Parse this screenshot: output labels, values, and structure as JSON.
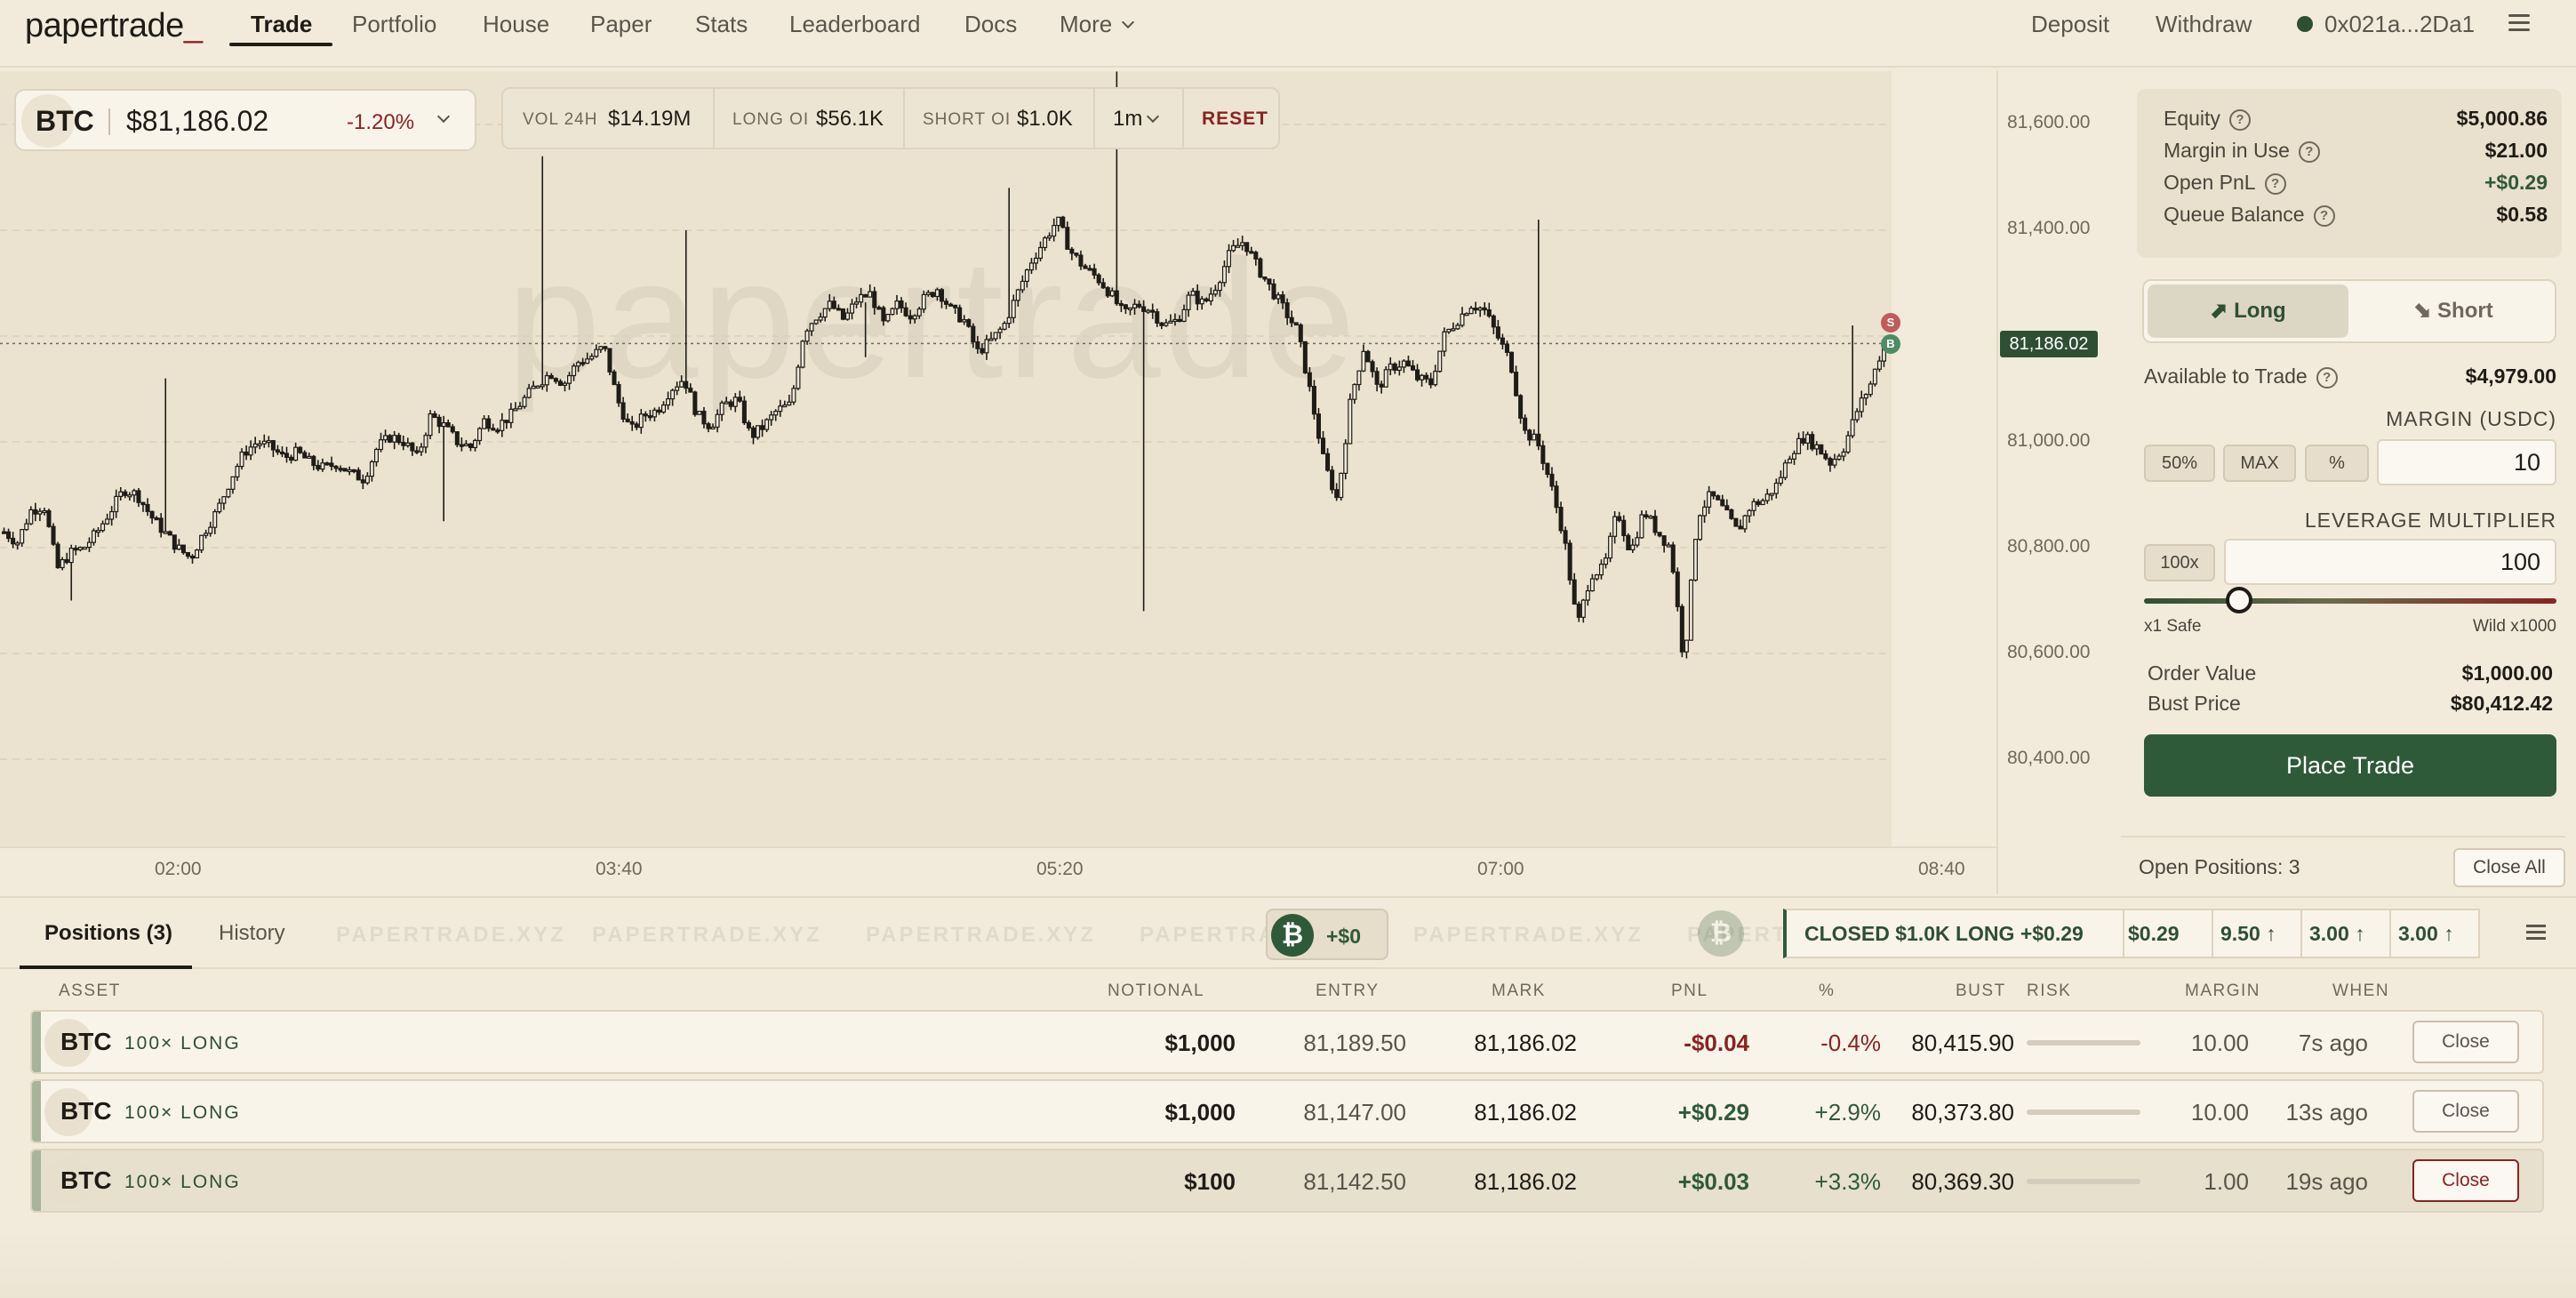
{
  "app": {
    "logo": "papertrade",
    "logo_cursor": "_"
  },
  "nav": {
    "items": [
      "Trade",
      "Portfolio",
      "House",
      "Paper",
      "Stats",
      "Leaderboard",
      "Docs",
      "More"
    ],
    "deposit": "Deposit",
    "withdraw": "Withdraw",
    "wallet": "0x021a...2Da1"
  },
  "ticker": {
    "symbol": "BTC",
    "price": "$81,186.02",
    "change": "-1.20%"
  },
  "stats": {
    "vol_label": "VOL 24H",
    "vol_value": "$14.19M",
    "long_label": "LONG OI",
    "long_value": "$56.1K",
    "short_label": "SHORT OI",
    "short_value": "$1.0K",
    "interval": "1m",
    "reset": "RESET"
  },
  "chart": {
    "watermark": "papertrade",
    "current_price": "81,186.02",
    "markers": [
      "S",
      "B"
    ]
  },
  "chart_data": {
    "type": "candlestick",
    "y_ticks": [
      "81,600.00",
      "81,400.00",
      "81,200.00",
      "81,000.00",
      "80,800.00",
      "80,600.00",
      "80,400.00"
    ],
    "y_tick_values": [
      81600,
      81400,
      81200,
      81000,
      80800,
      80600,
      80400
    ],
    "x_ticks": [
      "02:00",
      "03:40",
      "05:20",
      "07:00",
      "08:40"
    ],
    "ylim": [
      80300,
      81800
    ],
    "last_price": 81186.02,
    "close_path": [
      80830,
      80810,
      80870,
      80880,
      80760,
      80790,
      80800,
      80830,
      80870,
      80910,
      80900,
      80860,
      80830,
      80800,
      80780,
      80830,
      80870,
      80930,
      80980,
      81000,
      80990,
      80970,
      80980,
      80960,
      80950,
      80960,
      80940,
      80930,
      80990,
      81010,
      81000,
      80970,
      81050,
      81030,
      81000,
      80990,
      81040,
      81030,
      81050,
      81080,
      81110,
      81130,
      81110,
      81150,
      81160,
      81180,
      81080,
      81020,
      81050,
      81060,
      81100,
      81120,
      81050,
      81030,
      81070,
      81080,
      81010,
      81030,
      81060,
      81070,
      81210,
      81240,
      81260,
      81230,
      81270,
      81280,
      81220,
      81260,
      81240,
      81270,
      81290,
      81250,
      81230,
      81170,
      81190,
      81220,
      81280,
      81340,
      81380,
      81420,
      81360,
      81330,
      81310,
      81280,
      81240,
      81260,
      81250,
      81220,
      81230,
      81280,
      81260,
      81300,
      81360,
      81380,
      81330,
      81290,
      81250,
      81210,
      81090,
      80960,
      80890,
      81080,
      81180,
      81100,
      81140,
      81150,
      81120,
      81110,
      81200,
      81230,
      81260,
      81250,
      81200,
      81150,
      81020,
      81000,
      80920,
      80820,
      80650,
      80750,
      80760,
      80870,
      80790,
      80870,
      80830,
      80800,
      80580,
      80860,
      80900,
      80870,
      80830,
      80880,
      80890,
      80920,
      80980,
      81010,
      80990,
      80960,
      80990,
      81060,
      81110,
      81186
    ]
  },
  "account": {
    "equity_label": "Equity",
    "equity": "$5,000.86",
    "margin_label": "Margin in Use",
    "margin": "$21.00",
    "pnl_label": "Open PnL",
    "pnl": "+$0.29",
    "queue_label": "Queue Balance",
    "queue": "$0.58"
  },
  "trade": {
    "long": "Long",
    "short": "Short",
    "available_label": "Available to Trade",
    "available": "$4,979.00",
    "margin_label": "MARGIN (USDC)",
    "chip_50": "50%",
    "chip_max": "MAX",
    "chip_pct": "%",
    "margin_value": "10",
    "leverage_label": "LEVERAGE MULTIPLIER",
    "leverage_chip": "100x",
    "leverage_value": "100",
    "leverage_level": 0.23,
    "slider_min": "x1 Safe",
    "slider_max": "Wild x1000",
    "order_value_label": "Order Value",
    "order_value": "$1,000.00",
    "bust_label": "Bust Price",
    "bust": "$80,412.42",
    "place": "Place Trade",
    "open_positions": "Open Positions: 3",
    "close_all": "Close All"
  },
  "bottom": {
    "tab_positions": "Positions (3)",
    "tab_history": "History",
    "marquee": "PAPERTRADE.XYZ",
    "live_pnl": "+$0",
    "coin_glyph": "₿",
    "toasts": [
      "CLOSED $1.0K LONG +$0.29",
      "$0.29 ",
      "9.50 ↑",
      "3.00 ↑",
      "3.00 ↑"
    ]
  },
  "table": {
    "headers": [
      "ASSET",
      "NOTIONAL",
      "ENTRY",
      "MARK",
      "PNL",
      "%",
      "BUST",
      "RISK",
      "MARGIN",
      "WHEN"
    ],
    "rows": [
      {
        "symbol": "BTC",
        "side": "100× LONG",
        "notional": "$1,000",
        "entry": "81,189.50",
        "mark": "81,186.02",
        "pnl": "-$0.04",
        "pct": "-0.4%",
        "bust": "80,415.90",
        "margin": "10.00",
        "when": "7s ago",
        "close": "Close"
      },
      {
        "symbol": "BTC",
        "side": "100× LONG",
        "notional": "$1,000",
        "entry": "81,147.00",
        "mark": "81,186.02",
        "pnl": "+$0.29",
        "pct": "+2.9%",
        "bust": "80,373.80",
        "margin": "10.00",
        "when": "13s ago",
        "close": "Close"
      },
      {
        "symbol": "BTC",
        "side": "100× LONG",
        "notional": "$100",
        "entry": "81,142.50",
        "mark": "81,186.02",
        "pnl": "+$0.03",
        "pct": "+3.3%",
        "bust": "80,369.30",
        "margin": "1.00",
        "when": "19s ago",
        "close": "Close"
      }
    ]
  },
  "colors": {
    "accent_green": "#2f5a3a",
    "accent_red": "#8a2222",
    "background": "#f2ebdc"
  }
}
